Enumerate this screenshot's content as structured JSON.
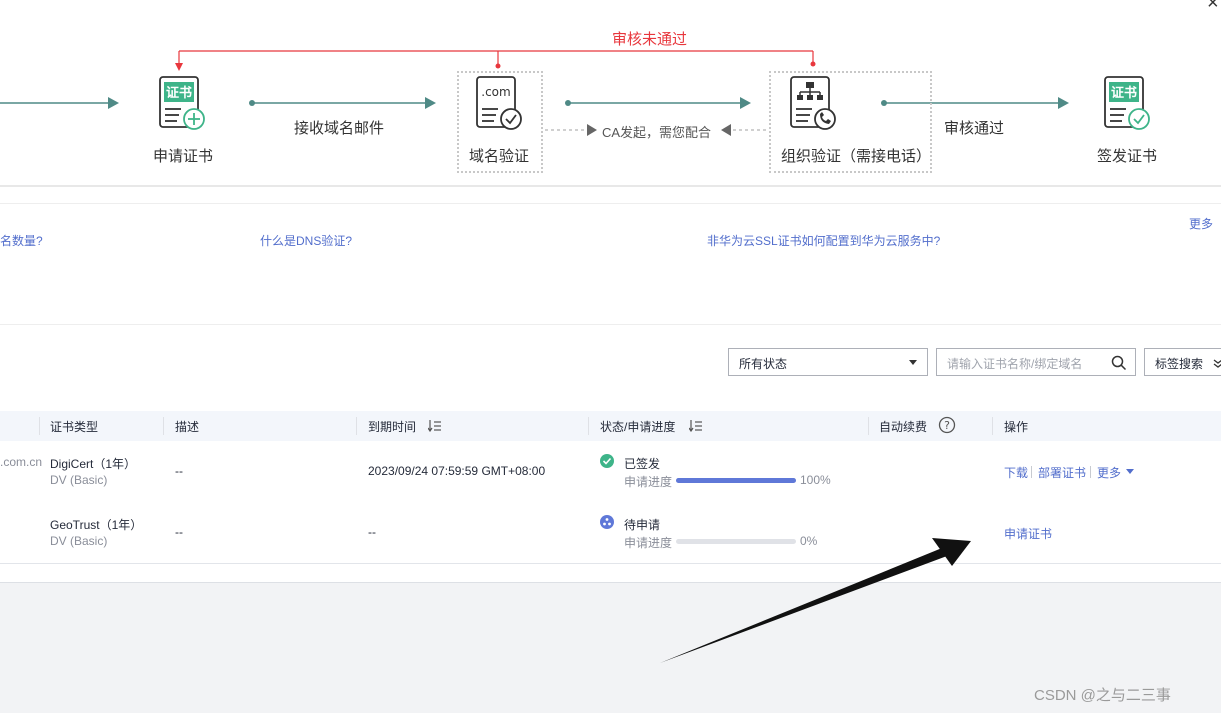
{
  "flow": {
    "steps": [
      {
        "label": "申请证书",
        "icon_text": "证书"
      },
      {
        "label": "域名验证",
        "icon_text": ".com"
      },
      {
        "label": "组织验证（需接电话）",
        "icon_text": ""
      },
      {
        "label": "签发证书",
        "icon_text": "证书"
      }
    ],
    "arrow_labels": [
      "接收域名邮件",
      "审核通过"
    ],
    "ca_label": "CA发起，需您配合",
    "reject_label": "审核未通过",
    "colors": {
      "arrow": "#4f8a86",
      "reject": "#e8373d",
      "icon_green": "#3eb489"
    }
  },
  "help_links": {
    "more": "更多",
    "items": [
      "名数量?",
      "什么是DNS验证?",
      "非华为云SSL证书如何配置到华为云服务中?"
    ]
  },
  "filter": {
    "status_select": "所有状态",
    "search_placeholder": "请输入证书名称/绑定域名",
    "tag_search": "标签搜索"
  },
  "table": {
    "headers": {
      "cert_type": "证书类型",
      "description": "描述",
      "expire": "到期时间",
      "status": "状态/申请进度",
      "auto_renew": "自动续费",
      "actions": "操作"
    },
    "rows": [
      {
        "domain_fragment": ".com.cn",
        "cert_type": "DigiCert（1年）",
        "cert_sub": "DV (Basic)",
        "description": "--",
        "expire": "2023/09/24 07:59:59 GMT+08:00",
        "status": "已签发",
        "progress_label": "申请进度",
        "progress": 100,
        "progress_text": "100%",
        "actions": [
          "下载",
          "部署证书",
          "更多"
        ]
      },
      {
        "domain_fragment": "",
        "cert_type": "GeoTrust（1年）",
        "cert_sub": "DV (Basic)",
        "description": "--",
        "expire": "--",
        "status": "待申请",
        "progress_label": "申请进度",
        "progress": 0,
        "progress_text": "0%",
        "actions": [
          "申请证书"
        ]
      }
    ]
  },
  "watermark": "CSDN @之与二三事",
  "close_symbol": "×"
}
